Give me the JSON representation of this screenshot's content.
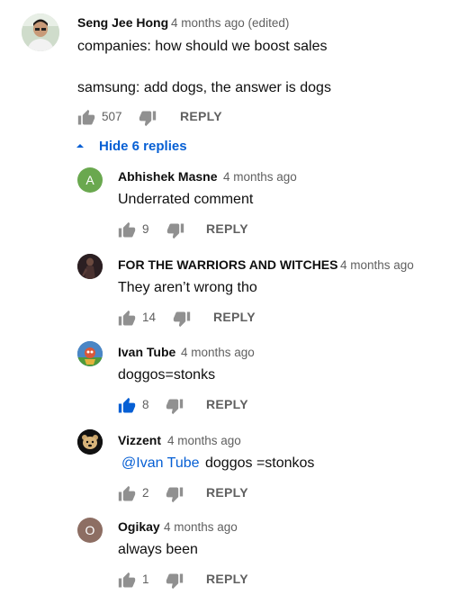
{
  "colors": {
    "link": "#065fd4",
    "meta": "#606060",
    "liked": "#065fd4"
  },
  "main_comment": {
    "author": "Seng Jee Hong",
    "time": "4 months ago (edited)",
    "line1": "companies: how should we boost sales",
    "line2": "samsung: add dogs, the answer is dogs",
    "likes": "507",
    "reply_label": "REPLY"
  },
  "hide_replies_label": "Hide 6 replies",
  "replies": [
    {
      "author": "Abhishek Masne",
      "time": "4 months ago",
      "text": "Underrated comment",
      "likes": "9",
      "reply_label": "REPLY",
      "avatar_letter": "A"
    },
    {
      "author": "FOR THE WARRIORS AND WITCHES",
      "time": "4 months ago",
      "text": "They aren’t wrong tho",
      "likes": "14",
      "reply_label": "REPLY"
    },
    {
      "author": "Ivan Tube",
      "time": "4 months ago",
      "text": "doggos=stonks",
      "likes": "8",
      "reply_label": "REPLY"
    },
    {
      "author": "Vizzent",
      "time": "4 months ago",
      "mention": "@Ivan Tube",
      "text": "doggos =stonkos",
      "likes": "2",
      "reply_label": "REPLY"
    },
    {
      "author": "Ogikay",
      "time": "4 months ago",
      "text": "always been",
      "likes": "1",
      "reply_label": "REPLY",
      "avatar_letter": "O"
    }
  ]
}
